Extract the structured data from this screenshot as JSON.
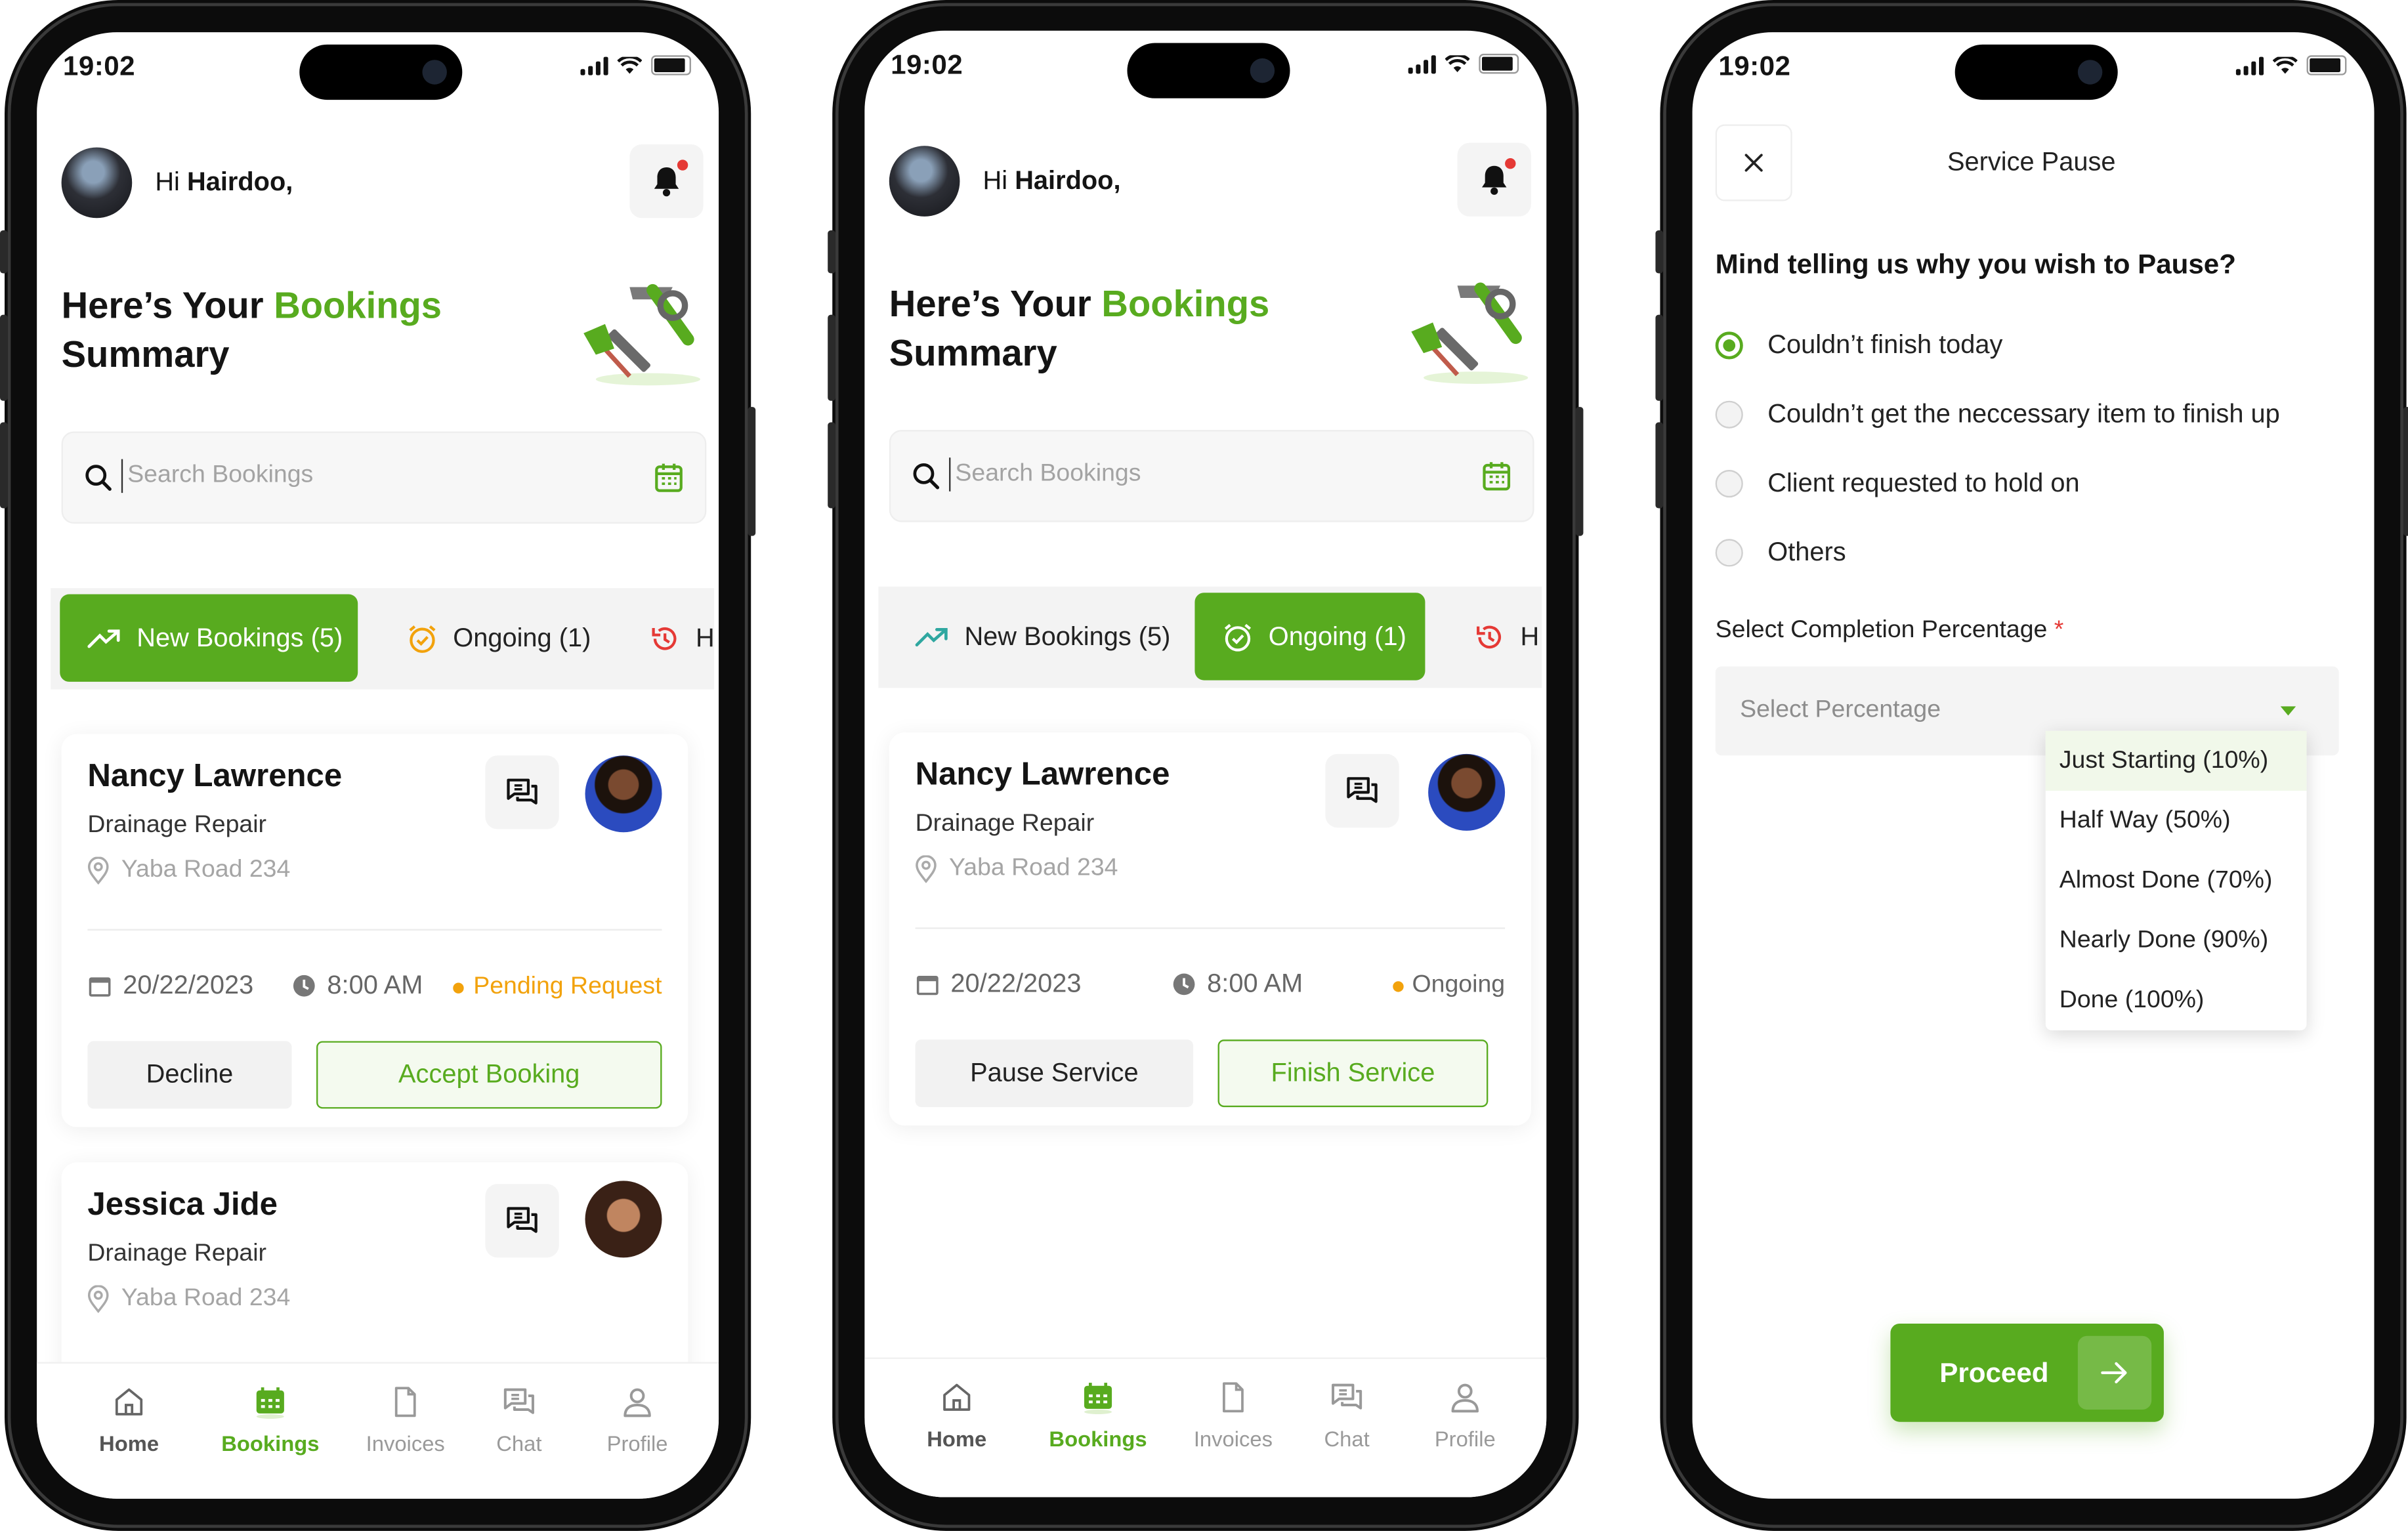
{
  "colors": {
    "accent": "#58ab1f",
    "pending": "#f2a20c",
    "notify": "#e53935"
  },
  "status_bar": {
    "time": "19:02"
  },
  "header": {
    "greeting": "Hi",
    "username": "Hairdoo,"
  },
  "summary": {
    "line1": "Here’s Your",
    "highlight": "Bookings",
    "line2": "Summary"
  },
  "search": {
    "placeholder": "Search Bookings"
  },
  "tabs": [
    {
      "label": "New Bookings (5)",
      "icon": "trending-up-icon"
    },
    {
      "label": "Ongoing (1)",
      "icon": "alarm-clock-icon"
    },
    {
      "label": "H",
      "icon": "history-icon"
    }
  ],
  "screen1": {
    "cards": [
      {
        "name": "Nancy Lawrence",
        "service": "Drainage Repair",
        "location": "Yaba Road 234",
        "date": "20/22/2023",
        "time": "8:00 AM",
        "status": "Pending Request",
        "decline": "Decline",
        "accept": "Accept Booking"
      },
      {
        "name": "Jessica Jide",
        "service": "Drainage Repair",
        "location": "Yaba Road 234"
      }
    ]
  },
  "screen2": {
    "card": {
      "name": "Nancy Lawrence",
      "service": "Drainage Repair",
      "location": "Yaba Road 234",
      "date": "20/22/2023",
      "time": "8:00 AM",
      "status": "Ongoing",
      "pause": "Pause Service",
      "finish": "Finish Service"
    }
  },
  "nav": [
    {
      "label": "Home",
      "icon": "home-icon"
    },
    {
      "label": "Bookings",
      "icon": "calendar-icon"
    },
    {
      "label": "Invoices",
      "icon": "document-icon"
    },
    {
      "label": "Chat",
      "icon": "chat-icon"
    },
    {
      "label": "Profile",
      "icon": "user-icon"
    }
  ],
  "pause_modal": {
    "title": "Service Pause",
    "question": "Mind telling us why you wish to Pause?",
    "reasons": [
      "Couldn’t finish today",
      "Couldn’t get the neccessary item to finish up",
      "Client requested to hold on",
      "Others"
    ],
    "selected_reason": "Couldn’t finish today",
    "percentage_label": "Select Completion Percentage",
    "required_mark": "*",
    "select_placeholder": "Select Percentage",
    "options": [
      "Just Starting (10%)",
      "Half Way (50%)",
      "Almost Done (70%)",
      "Nearly Done (90%)",
      "Done (100%)"
    ],
    "highlighted_option": "Just Starting (10%)",
    "proceed": "Proceed"
  }
}
